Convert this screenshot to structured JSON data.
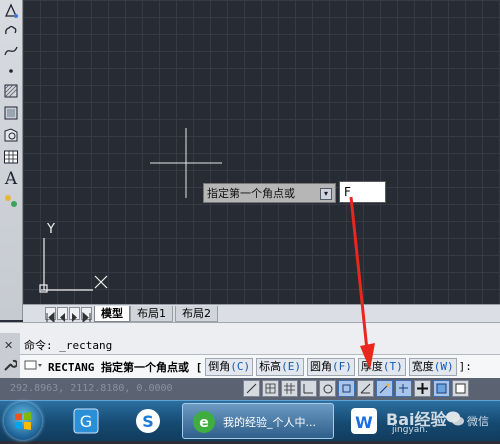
{
  "canvas": {
    "ucs_y_label": "Y",
    "dynamic_prompt": "指定第一个角点或",
    "dynamic_input_value": "F",
    "dropdown_arrow": "▾"
  },
  "layout_tabs": [
    "模型",
    "布局1",
    "布局2"
  ],
  "command": {
    "history_line": "命令:  _rectang",
    "prompt_text": "RECTANG 指定第一个角点或 [",
    "options": [
      {
        "label": "倒角",
        "key": "(C)"
      },
      {
        "label": "标高",
        "key": "(E)"
      },
      {
        "label": "圆角",
        "key": "(F)"
      },
      {
        "label": "厚度",
        "key": "(T)"
      },
      {
        "label": "宽度",
        "key": "(W)"
      }
    ],
    "close_bracket": "]:"
  },
  "status": {
    "coords": "292.8963,  2112.8180, 0.0000"
  },
  "taskbar": {
    "browser_task": "我的经验_个人中..."
  },
  "watermark": {
    "baidu": "Bai经验",
    "site": "jingyan.",
    "wechat": "微信"
  },
  "colors": {
    "canvas_bg": "#272b34",
    "crosshair": "#e6e6e6",
    "annotation_arrow": "#e8281c",
    "option_key": "#1358b8"
  }
}
